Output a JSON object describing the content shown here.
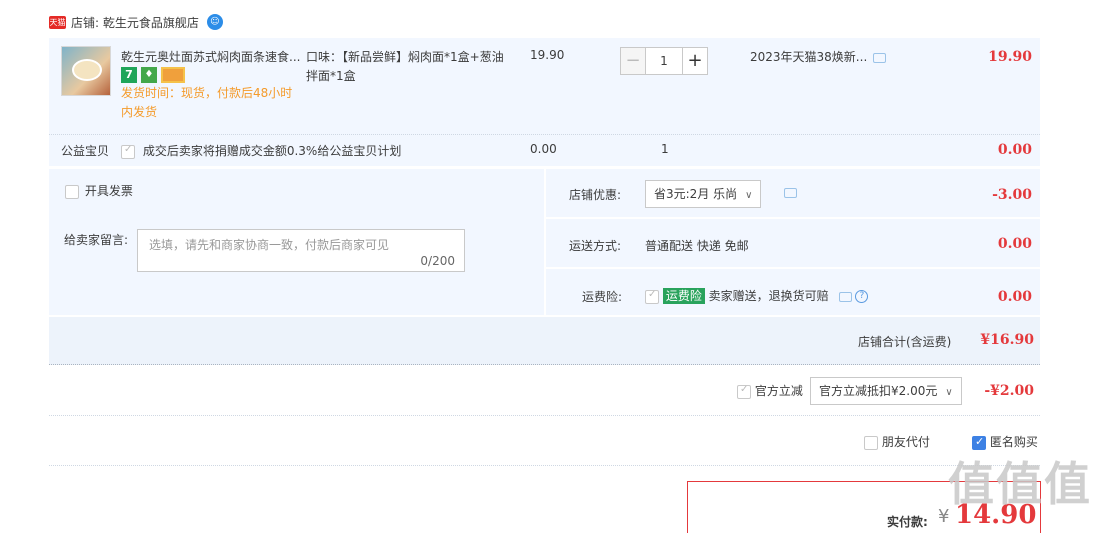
{
  "shop": {
    "badge": "天猫",
    "label": "店铺: 乾生元食品旗舰店",
    "chat_icon": "wangwang-icon"
  },
  "item": {
    "title": "乾生元奥灶面苏式焖肉面条速食...",
    "badge_7": "7",
    "badge_q": "♦",
    "ship_text": "发货时间：现货，付款后48小时内发货",
    "spec": "口味：【新品尝鲜】焖肉面*1盒+葱油拌面*1盒",
    "price": "19.90",
    "quantity": "1",
    "minus": "−",
    "plus": "+",
    "promo": "2023年天猫38焕新...",
    "subtotal": "19.90"
  },
  "charity": {
    "label": "公益宝贝",
    "text": "成交后卖家将捐赠成交金额0.3%给公益宝贝计划",
    "price": "0.00",
    "qty": "1",
    "subtotal": "0.00"
  },
  "invoice": {
    "label": "开具发票"
  },
  "message": {
    "label": "给卖家留言:",
    "placeholder": "选填，请先和商家协商一致，付款后商家可见",
    "counter": "0/200"
  },
  "discount": {
    "label": "店铺优惠:",
    "selected": "省3元:2月 乐尚",
    "amount": "-3.00"
  },
  "shipping": {
    "label": "运送方式:",
    "value": "普通配送 快递 免邮",
    "amount": "0.00"
  },
  "insurance": {
    "label": "运费险:",
    "tag": "运费险",
    "text": "卖家赠送，退换货可赔",
    "amount": "0.00"
  },
  "shop_total": {
    "label": "店铺合计(含运费)",
    "amount": "¥16.90"
  },
  "official": {
    "label": "官方立减",
    "selected": "官方立减抵扣¥2.00元",
    "amount": "-¥2.00"
  },
  "friend_pay": {
    "label": "朋友代付"
  },
  "anonymous": {
    "label": "匿名购买"
  },
  "pay": {
    "label": "实付款:",
    "currency": "¥",
    "amount": "14.90"
  },
  "watermark": {
    "logo": "值",
    "url": "什么值得买"
  }
}
